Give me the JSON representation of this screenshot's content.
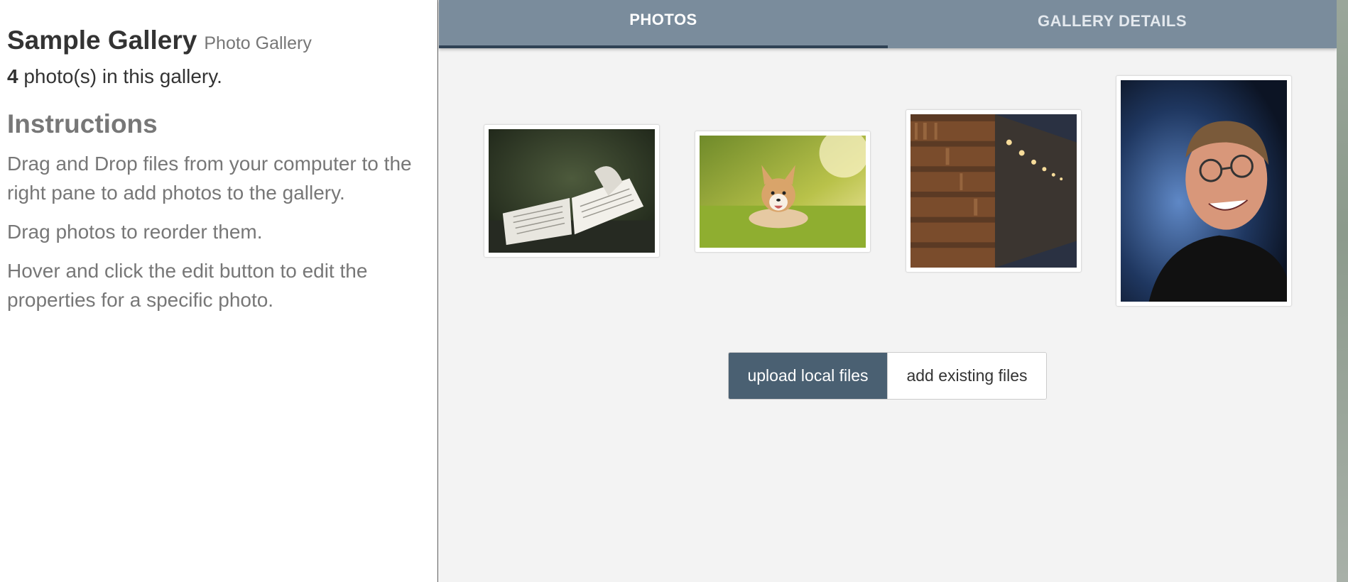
{
  "sidebar": {
    "title": "Sample Gallery",
    "subtitle": "Photo Gallery",
    "photo_count": "4",
    "photo_count_suffix": " photo(s) in this gallery.",
    "instructions_heading": "Instructions",
    "instructions": [
      "Drag and Drop files from your computer to the right pane to add photos to the gallery.",
      "Drag photos to reorder them.",
      "Hover and click the edit button to edit the properties for a specific photo."
    ]
  },
  "tabs": [
    {
      "label": "PHOTOS",
      "active": true
    },
    {
      "label": "GALLERY DETAILS",
      "active": false
    }
  ],
  "photos": [
    {
      "subject": "open book"
    },
    {
      "subject": "corgi dog on grass"
    },
    {
      "subject": "library bookshelves"
    },
    {
      "subject": "portrait of smiling man"
    }
  ],
  "buttons": {
    "upload": "upload local files",
    "existing": "add existing files"
  },
  "colors": {
    "tab_bar": "#7a8c9c",
    "tab_indicator": "#2f4255",
    "primary_button": "#4a6072",
    "pane_background": "#f3f3f3"
  }
}
